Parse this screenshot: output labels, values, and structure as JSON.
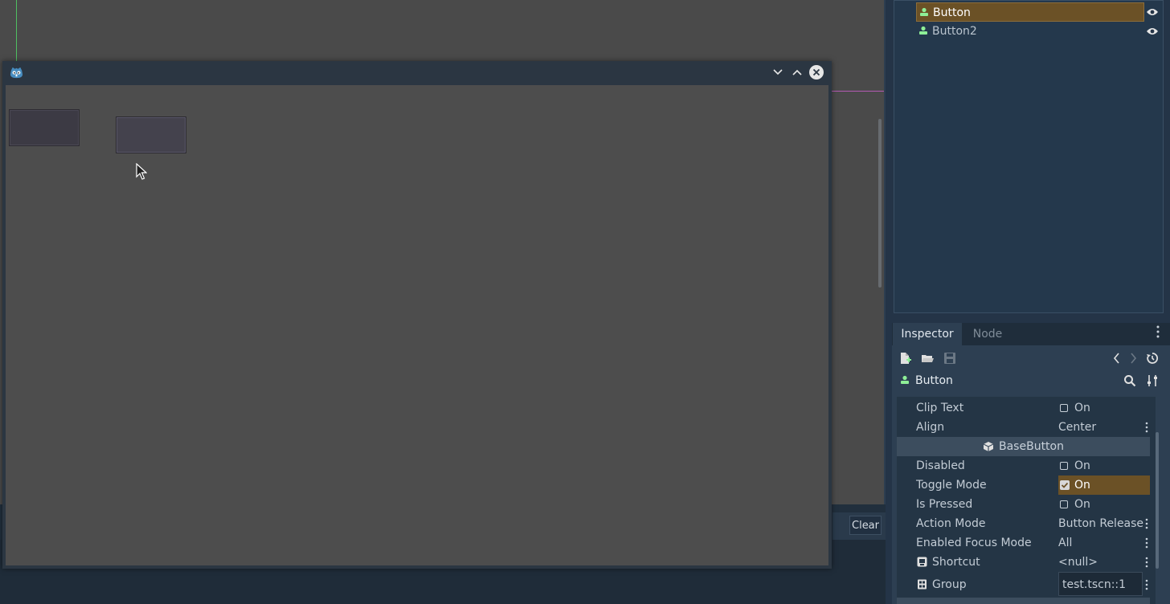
{
  "scene_tree": {
    "items": [
      {
        "label": "Button",
        "selected": true
      },
      {
        "label": "Button2",
        "selected": false
      }
    ]
  },
  "inspector": {
    "tabs": [
      "Inspector",
      "Node"
    ],
    "object_name": "Button",
    "properties": [
      {
        "name": "Clip Text",
        "value": "On",
        "checked": false
      },
      {
        "name": "Align",
        "value": "Center"
      },
      {
        "name": "Disabled",
        "value": "On",
        "checked": false
      },
      {
        "name": "Toggle Mode",
        "value": "On",
        "checked": true
      },
      {
        "name": "Is Pressed",
        "value": "On",
        "checked": false
      },
      {
        "name": "Action Mode",
        "value": "Button Release"
      },
      {
        "name": "Enabled Focus Mode",
        "value": "All"
      },
      {
        "name": "Shortcut",
        "value": "<null>"
      },
      {
        "name": "Group",
        "value": "test.tscn::1"
      }
    ],
    "section": "BaseButton"
  },
  "output_panel": {
    "clear_label": "Clear"
  },
  "colors": {
    "accent_selected": "#6b5126",
    "node_icon_green": "#8eef97",
    "editor_bg": "#243447"
  }
}
